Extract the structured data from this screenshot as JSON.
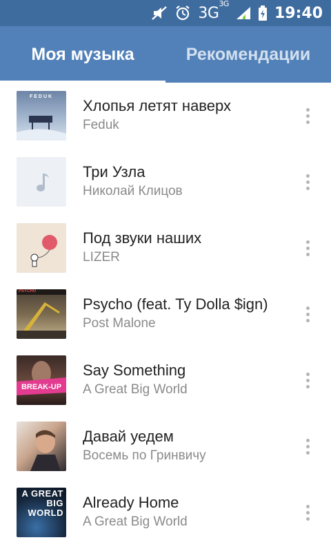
{
  "status_bar": {
    "network": "3G",
    "network_sup": "3G",
    "time": "19:40"
  },
  "tabs": [
    {
      "label": "Моя музыка",
      "active": true
    },
    {
      "label": "Рекомендации",
      "active": false
    }
  ],
  "tracks": [
    {
      "title": "Хлопья летят наверх",
      "artist": "Feduk",
      "cover": "winter-piano-cover",
      "cover_text": "FEDUK"
    },
    {
      "title": "Три Узла",
      "artist": "Николай Клицов",
      "cover": "music-note-placeholder"
    },
    {
      "title": "Под звуки наших",
      "artist": "LIZER",
      "cover": "balloon-cover"
    },
    {
      "title": "Psycho (feat. Ty Dolla $ign)",
      "artist": "Post Malone",
      "cover": "crane-cover",
      "cover_text": "PSYCHO"
    },
    {
      "title": "Say Something",
      "artist": "A Great Big World",
      "cover": "break-up-songs-cover",
      "cover_text": "BREAK-UP"
    },
    {
      "title": "Давай уедем",
      "artist": "Восемь по Гринвичу",
      "cover": "portrait-cover"
    },
    {
      "title": "Already Home",
      "artist": "A Great Big World",
      "cover": "great-big-world-cover",
      "cover_text": "A GREAT BIG WORLD"
    }
  ],
  "colors": {
    "status_bar": "#3f6c9f",
    "app_bar": "#5181b8",
    "title_text": "#222222",
    "artist_text": "#8a8a8a"
  }
}
